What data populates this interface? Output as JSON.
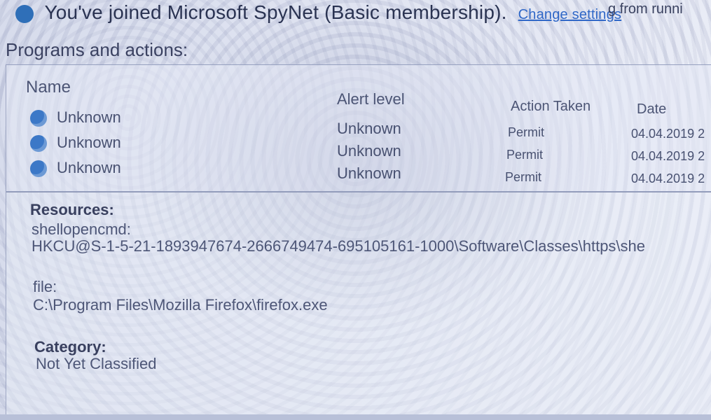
{
  "notice": {
    "text": "You've joined Microsoft SpyNet (Basic membership).",
    "link": "Change settings",
    "right_fragment": "g from runni"
  },
  "section": {
    "title": "Programs and actions:"
  },
  "table": {
    "headers": {
      "name": "Name",
      "alert_level": "Alert level",
      "action_taken": "Action Taken",
      "date": "Date"
    },
    "rows": [
      {
        "name": "Unknown",
        "alert_level": "Unknown",
        "action_taken": "Permit",
        "date": "04.04.2019 2"
      },
      {
        "name": "Unknown",
        "alert_level": "Unknown",
        "action_taken": "Permit",
        "date": "04.04.2019 2"
      },
      {
        "name": "Unknown",
        "alert_level": "Unknown",
        "action_taken": "Permit",
        "date": "04.04.2019 2"
      }
    ]
  },
  "details": {
    "resources_label": "Resources:",
    "resources_key": "shellopencmd:",
    "resources_path": "HKCU@S-1-5-21-1893947674-2666749474-695105161-1000\\Software\\Classes\\https\\she",
    "file_label": "file:",
    "file_path": "C:\\Program Files\\Mozilla Firefox\\firefox.exe",
    "category_label": "Category:",
    "category_value": "Not Yet Classified"
  },
  "colors": {
    "link": "#2f67c7",
    "row_icon": "#3c78c7"
  },
  "icons": {
    "row_icon": "shield-question-icon"
  }
}
